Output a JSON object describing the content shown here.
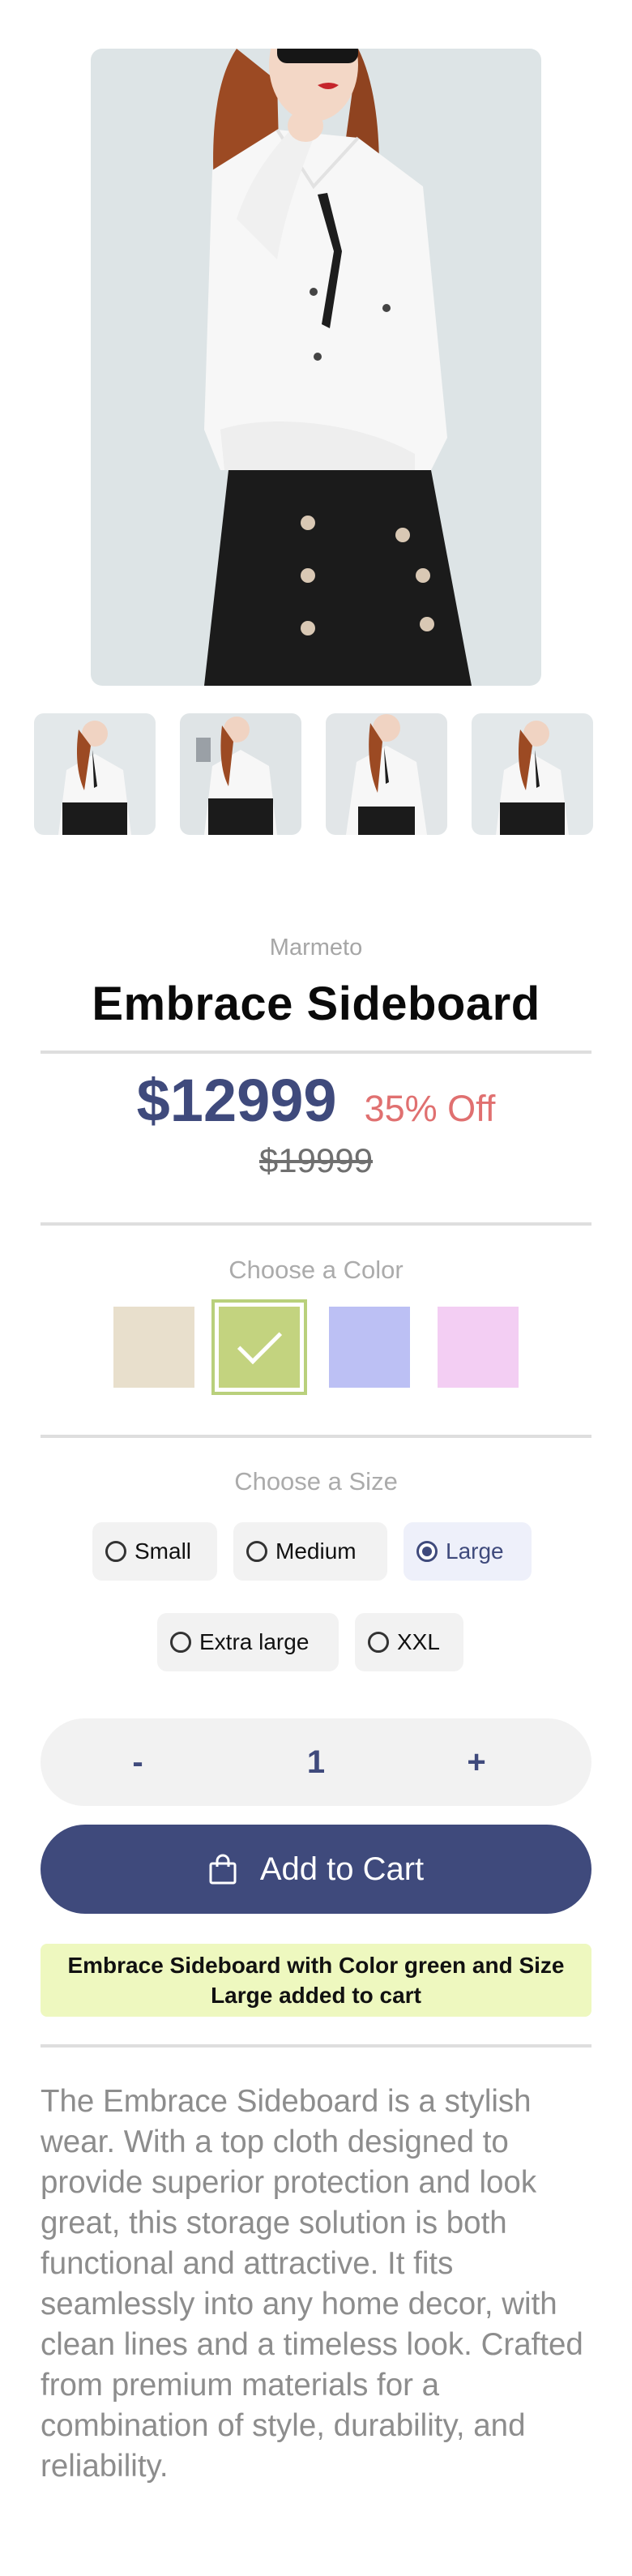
{
  "product": {
    "vendor": "Marmeto",
    "title": "Embrace Sideboard",
    "price": "$12999",
    "discount": "35% Off",
    "compare_price": "$19999"
  },
  "gallery": {
    "main_image": "model-white-shirt-photo",
    "thumbnails": [
      "thumbnail-1",
      "thumbnail-2",
      "thumbnail-3",
      "thumbnail-4"
    ]
  },
  "color_picker": {
    "label": "Choose a Color",
    "options": [
      {
        "name": "beige",
        "hex": "#e8dfcc"
      },
      {
        "name": "green",
        "hex": "#c3d37f",
        "selected": true
      },
      {
        "name": "blue",
        "hex": "#bcc0f4"
      },
      {
        "name": "pink",
        "hex": "#f3cef3"
      }
    ]
  },
  "size_picker": {
    "label": "Choose a Size",
    "options": [
      {
        "label": "Small",
        "selected": false
      },
      {
        "label": "Medium",
        "selected": false
      },
      {
        "label": "Large",
        "selected": true
      },
      {
        "label": "Extra large",
        "selected": false
      },
      {
        "label": "XXL",
        "selected": false
      }
    ]
  },
  "quantity": {
    "minus": "-",
    "value": "1",
    "plus": "+"
  },
  "cart": {
    "button_label": "Add to Cart",
    "icon": "shopping-bag-icon"
  },
  "notice": "Embrace Sideboard with Color green and Size Large added to cart",
  "description": "The Embrace Sideboard is a stylish wear. With a top cloth designed to provide superior protection and look great, this storage solution is both functional and attractive. It fits seamlessly into any home decor, with clean lines and a timeless look. Crafted from premium materials for a combination of style, durability, and reliability.",
  "colors": {
    "accent": "#3f4a7c",
    "discount": "#e07070",
    "notice_bg": "#eef8bf"
  }
}
